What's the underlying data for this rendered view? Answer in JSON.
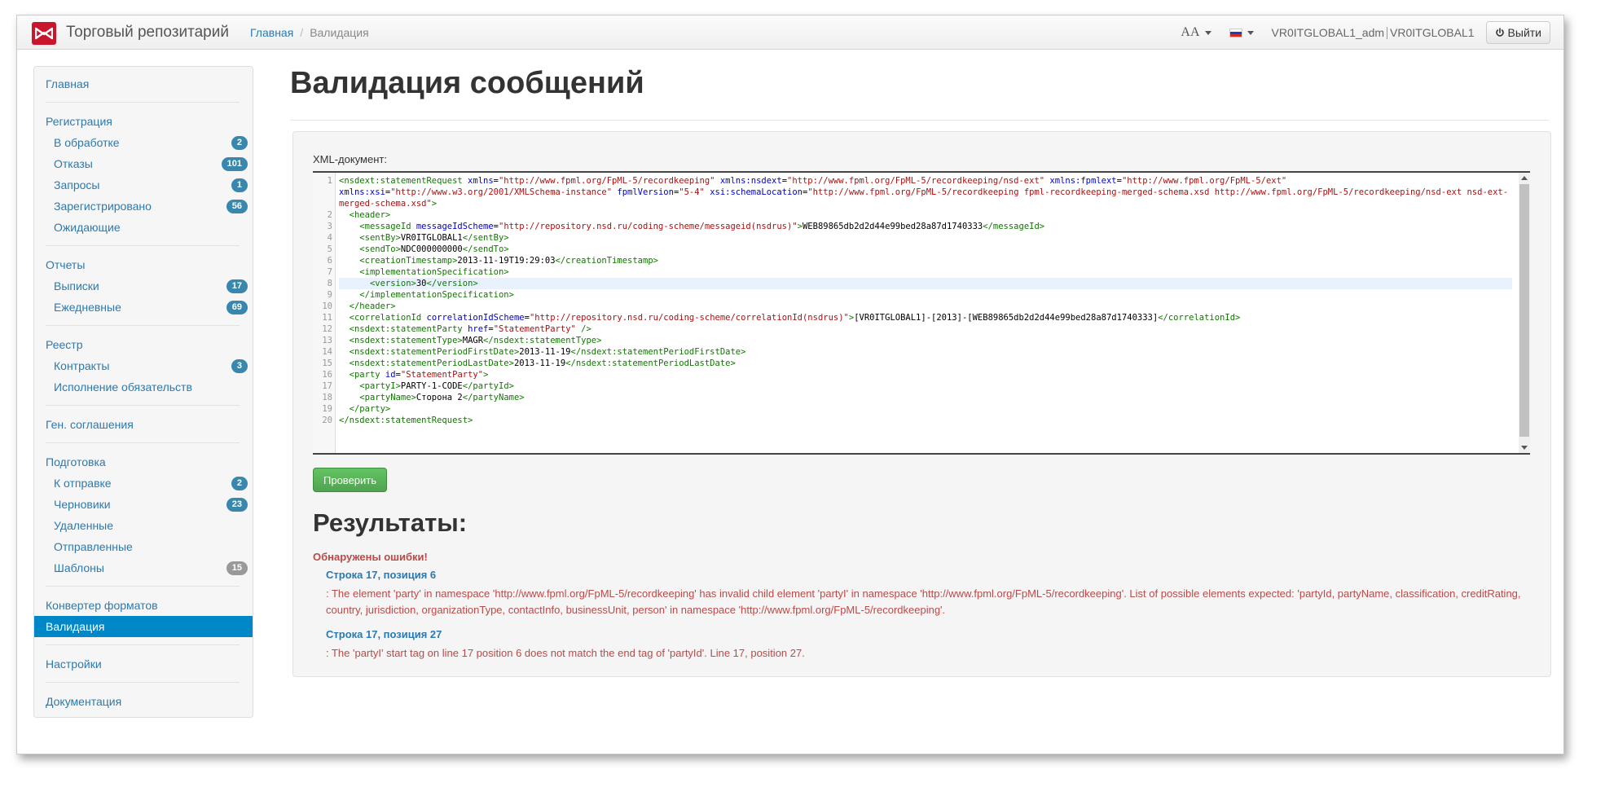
{
  "app": {
    "brand": "Торговый репозитарий",
    "logo_icon": "moex-logo-icon"
  },
  "breadcrumb": {
    "home": "Главная",
    "current": "Валидация"
  },
  "navbar": {
    "font_icon": "AA",
    "language_flag": "ru-flag-icon",
    "user_login": "VR0ITGLOBAL1_adm",
    "user_org": "VR0ITGLOBAL1",
    "logout_label": "Выйти"
  },
  "sidebar": {
    "home": "Главная",
    "registration": "Регистрация",
    "reg_items": [
      {
        "label": "В обработке",
        "badge": "2"
      },
      {
        "label": "Отказы",
        "badge": "101"
      },
      {
        "label": "Запросы",
        "badge": "1"
      },
      {
        "label": "Зарегистрировано",
        "badge": "56"
      },
      {
        "label": "Ожидающие",
        "badge": ""
      }
    ],
    "reports": "Отчеты",
    "report_items": [
      {
        "label": "Выписки",
        "badge": "17"
      },
      {
        "label": "Ежедневные",
        "badge": "69"
      }
    ],
    "registry": "Реестр",
    "registry_items": [
      {
        "label": "Контракты",
        "badge": "3"
      },
      {
        "label": "Исполнение обязательств",
        "badge": ""
      }
    ],
    "general_agreements": "Ген. соглашения",
    "preparation": "Подготовка",
    "prep_items": [
      {
        "label": "К отправке",
        "badge": "2"
      },
      {
        "label": "Черновики",
        "badge": "23"
      },
      {
        "label": "Удаленные",
        "badge": ""
      },
      {
        "label": "Отправленные",
        "badge": ""
      },
      {
        "label": "Шаблоны",
        "badge": "15"
      }
    ],
    "format_converter": "Конвертер форматов",
    "validation": "Валидация",
    "settings": "Настройки",
    "documentation": "Документация"
  },
  "main": {
    "title": "Валидация сообщений",
    "xml_label": "XML-документ:",
    "check_button": "Проверить",
    "results_title": "Результаты:",
    "errors_found": "Обнаружены ошибки!",
    "errors": [
      {
        "position": "Строка 17, позиция 6",
        "message": ": The element 'party' in namespace 'http://www.fpml.org/FpML-5/recordkeeping' has invalid child element 'partyI' in namespace 'http://www.fpml.org/FpML-5/recordkeeping'. List of possible elements expected: 'partyId, partyName, classification, creditRating, country, jurisdiction, organizationType, contactInfo, businessUnit, person' in namespace 'http://www.fpml.org/FpML-5/recordkeeping'."
      },
      {
        "position": "Строка 17, позиция 27",
        "message": ": The 'partyI' start tag on line 17 position 6 does not match the end tag of 'partyId'. Line 17, position 27."
      }
    ]
  },
  "xml_lines": [
    "<nsdext:statementRequest xmlns=\"http://www.fpml.org/FpML-5/recordkeeping\" xmlns:nsdext=\"http://www.fpml.org/FpML-5/recordkeeping/nsd-ext\" xmlns:fpmlext=\"http://www.fpml.org/FpML-5/ext\" xmlns:xsi=\"http://www.w3.org/2001/XMLSchema-instance\" fpmlVersion=\"5-4\" xsi:schemaLocation=\"http://www.fpml.org/FpML-5/recordkeeping fpml-recordkeeping-merged-schema.xsd http://www.fpml.org/FpML-5/recordkeeping/nsd-ext nsd-ext-merged-schema.xsd\">",
    "  <header>",
    "    <messageId messageIdScheme=\"http://repository.nsd.ru/coding-scheme/messageid(nsdrus)\">WEB89865db2d2d44e99bed28a87d1740333</messageId>",
    "    <sentBy>VR0ITGLOBAL1</sentBy>",
    "    <sendTo>NDC000000000</sendTo>",
    "    <creationTimestamp>2013-11-19T19:29:03</creationTimestamp>",
    "    <implementationSpecification>",
    "      <version>30</version>",
    "    </implementationSpecification>",
    "  </header>",
    "  <correlationId correlationIdScheme=\"http://repository.nsd.ru/coding-scheme/correlationId(nsdrus)\">[VR0ITGLOBAL1]-[2013]-[WEB89865db2d2d44e99bed28a87d1740333]</correlationId>",
    "  <nsdext:statementParty href=\"StatementParty\" />",
    "  <nsdext:statementType>MAGR</nsdext:statementType>",
    "  <nsdext:statementPeriodFirstDate>2013-11-19</nsdext:statementPeriodFirstDate>",
    "  <nsdext:statementPeriodLastDate>2013-11-19</nsdext:statementPeriodLastDate>",
    "  <party id=\"StatementParty\">",
    "    <partyI>PARTY-1-CODE</partyId>",
    "    <partyName>Сторона 2</partyName>",
    "  </party>",
    "</nsdext:statementRequest>"
  ]
}
